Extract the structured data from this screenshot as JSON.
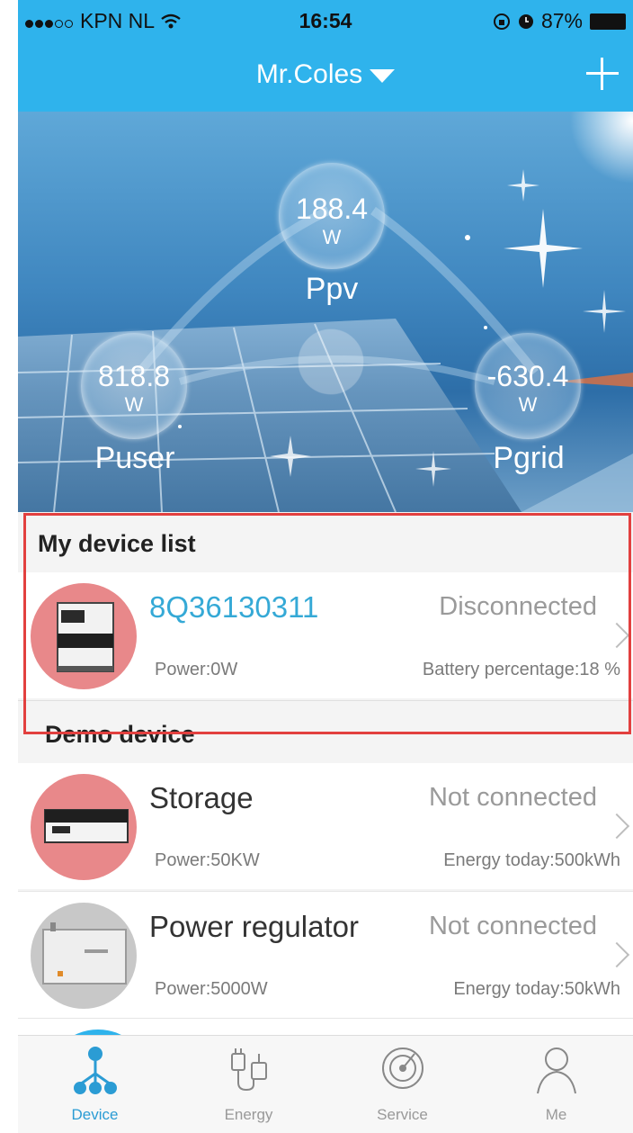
{
  "status_bar": {
    "carrier": "KPN NL",
    "time": "16:54",
    "battery": "87%"
  },
  "navbar": {
    "title": "Mr.Coles"
  },
  "hero": {
    "ppv": {
      "value": "188.4",
      "unit": "W",
      "label": "Ppv"
    },
    "puser": {
      "value": "818.8",
      "unit": "W",
      "label": "Puser"
    },
    "pgrid": {
      "value": "-630.4",
      "unit": "W",
      "label": "Pgrid"
    }
  },
  "my_devices": {
    "header": "My device list",
    "items": [
      {
        "name": "8Q36130311",
        "status": "Disconnected",
        "left": "Power:0W",
        "right": "Battery percentage:18 %"
      }
    ]
  },
  "demo_devices": {
    "header": "Demo device",
    "items": [
      {
        "name": "Storage",
        "status": "Not connected",
        "left": "Power:50KW",
        "right": "Energy today:500kWh"
      },
      {
        "name": "Power regulator",
        "status": "Not connected",
        "left": "Power:5000W",
        "right": "Energy today:50kWh"
      }
    ]
  },
  "tabbar": {
    "tabs": [
      {
        "label": "Device",
        "icon": "device-network-icon",
        "active": true
      },
      {
        "label": "Energy",
        "icon": "energy-plug-icon",
        "active": false
      },
      {
        "label": "Service",
        "icon": "service-radar-icon",
        "active": false
      },
      {
        "label": "Me",
        "icon": "person-icon",
        "active": false
      }
    ]
  },
  "colors": {
    "accent": "#2fb3ec",
    "active_tab": "#2b9cd4",
    "highlight_border": "#e2403f"
  }
}
